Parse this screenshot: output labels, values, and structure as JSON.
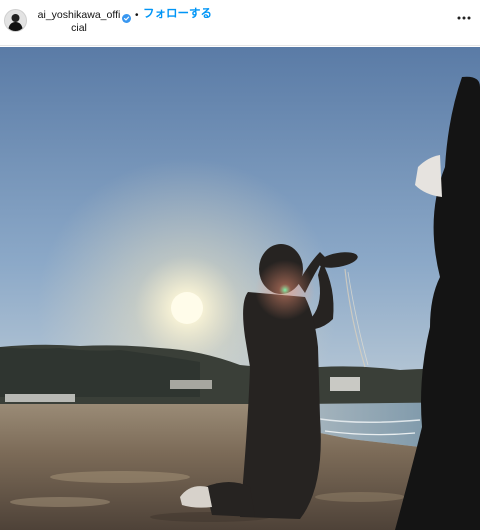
{
  "post": {
    "username": "ai_yoshikawa_official",
    "separator": "•",
    "follow_label": "フォローする",
    "verified_icon": "verified-badge-icon",
    "more_icon": "more-options-icon"
  },
  "colors": {
    "follow": "#0095f6",
    "sky_top": "#5f7fa8",
    "sun": "#fffbe8",
    "sand": "#7c6a57"
  },
  "photo": {
    "scene": "beach-sunset-photo"
  }
}
